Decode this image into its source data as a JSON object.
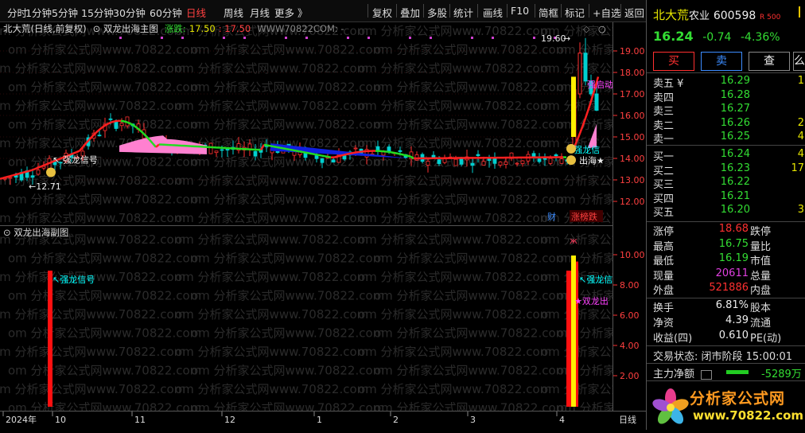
{
  "toolbar": {
    "periods": [
      "分时",
      "1分钟",
      "5分钟",
      "15分钟",
      "30分钟",
      "60分钟",
      "日线",
      "周线",
      "月线",
      "更多 》"
    ],
    "active_period": "日线",
    "tools": [
      "复权",
      "叠加",
      "多股",
      "统计",
      "画线",
      "F10",
      "简框",
      "标记",
      "+自选",
      "返回"
    ]
  },
  "main_header": {
    "stock_label": "北大荒(日线,前复权)",
    "indicator": "双龙出海主图",
    "ind_label": "涨跌:",
    "ind_val1": "17.50",
    "ind_val2": "17.50",
    "source": "WWW70822COM: -"
  },
  "sub_header": {
    "title": "双龙出海副图"
  },
  "watermark": "om 分析家公式网www.70822.com",
  "price_axis": [
    "19.00",
    "18.00",
    "17.00",
    "16.00",
    "15.00",
    "14.00",
    "13.00",
    "12.00"
  ],
  "sub_axis": [
    "10.00",
    "8.00",
    "6.00",
    "4.00",
    "2.00"
  ],
  "date_axis": [
    "2024年",
    "10",
    "11",
    "12",
    "1",
    "2",
    "3",
    "4"
  ],
  "period_tag": "日线",
  "annotations": {
    "high_label": "19.60",
    "low_label": "12.71",
    "main_signal": "强龙信号",
    "strong_start": "强启动",
    "dragon_sig": "强龙信",
    "out_sea": "出海★",
    "cai": "财",
    "rank": "涨榜跌",
    "sub_signal": "强龙信号",
    "sub_dragon": "强龙信",
    "sub_out": "★双龙出"
  },
  "stock": {
    "name": "北大荒",
    "sector": "农业",
    "code": "600598",
    "badge": "R 500",
    "price": "16.24",
    "change": "-0.74",
    "change_pct": "-4.36%",
    "buy_btn": "买",
    "sell_btn": "卖",
    "query_btn": "查",
    "other_btn": "么"
  },
  "asks": [
    {
      "label": "卖五 ¥",
      "price": "16.29",
      "vol": "1"
    },
    {
      "label": "卖四",
      "price": "16.28",
      "vol": ""
    },
    {
      "label": "卖三",
      "price": "16.27",
      "vol": ""
    },
    {
      "label": "卖二",
      "price": "16.26",
      "vol": "2"
    },
    {
      "label": "卖一",
      "price": "16.25",
      "vol": "4"
    }
  ],
  "bids": [
    {
      "label": "买一",
      "price": "16.24",
      "vol": "4"
    },
    {
      "label": "买二",
      "price": "16.23",
      "vol": "17"
    },
    {
      "label": "买三",
      "price": "16.22",
      "vol": ""
    },
    {
      "label": "买四",
      "price": "16.21",
      "vol": ""
    },
    {
      "label": "买五",
      "price": "16.20",
      "vol": "3"
    }
  ],
  "stats": [
    {
      "l1": "涨停",
      "v1": "18.68",
      "c1": "red",
      "l2": "跌停"
    },
    {
      "l1": "最高",
      "v1": "16.75",
      "c1": "green",
      "l2": "量比"
    },
    {
      "l1": "最低",
      "v1": "16.19",
      "c1": "green",
      "l2": "市值"
    },
    {
      "l1": "现量",
      "v1": "20611",
      "c1": "mag",
      "l2": "总量"
    },
    {
      "l1": "外盘",
      "v1": "521886",
      "c1": "red",
      "l2": "内盘"
    }
  ],
  "fund": [
    {
      "l1": "换手",
      "v1": "6.81%",
      "l2": "股本"
    },
    {
      "l1": "净资",
      "v1": "4.39",
      "l2": "流通"
    },
    {
      "l1": "收益(四)",
      "v1": "0.610",
      "l2": "PE(动)"
    }
  ],
  "trade_status": "交易状态: 闭市阶段 15:00:01",
  "main_flow_label": "主力净额",
  "main_flow_value": "-5289万",
  "brand": {
    "cn": "分析家公式网",
    "url": "www.70822.com"
  }
}
